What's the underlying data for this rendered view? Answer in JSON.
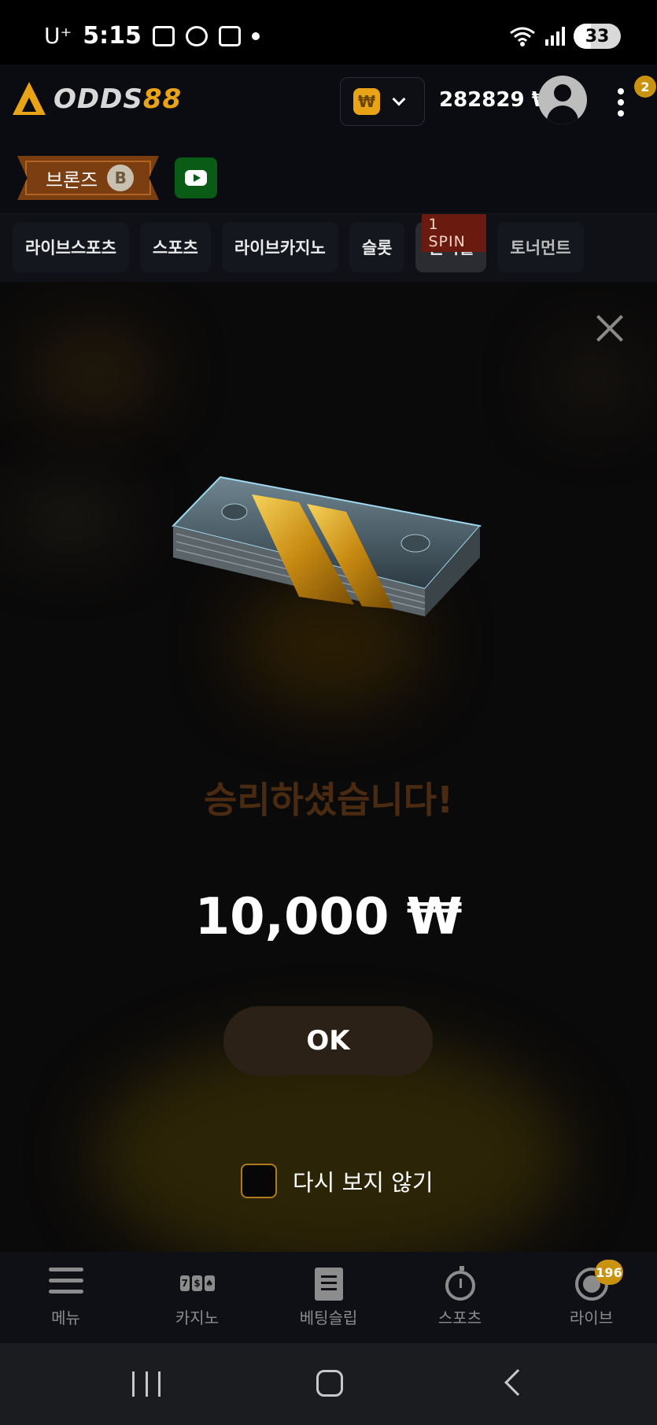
{
  "status_bar": {
    "carrier": "U⁺",
    "time": "5:15",
    "battery": "33"
  },
  "header": {
    "logo_text_a": "ODDS",
    "logo_text_b": "88",
    "currency_symbol": "₩",
    "balance": "282829 ₩",
    "notification_count": "2"
  },
  "rank": {
    "label": "브론즈",
    "coin_letter": "B"
  },
  "nav_tabs": [
    {
      "label": "라이브스포츠"
    },
    {
      "label": "스포츠"
    },
    {
      "label": "라이브카지노"
    },
    {
      "label": "슬롯"
    },
    {
      "label": "원더휠",
      "tag": "1 SPIN"
    },
    {
      "label": "토너먼트"
    }
  ],
  "modal": {
    "title": "승리하셨습니다!",
    "amount": "10,000 ₩",
    "ok_label": "OK",
    "dont_show_label": "다시 보지 않기"
  },
  "bottom_nav": [
    {
      "label": "메뉴"
    },
    {
      "label": "카지노"
    },
    {
      "label": "베팅슬립"
    },
    {
      "label": "스포츠"
    },
    {
      "label": "라이브",
      "badge": "196"
    }
  ],
  "colors": {
    "accent": "#e8a317",
    "background": "#0b0a0a",
    "header": "#0a0c12"
  }
}
